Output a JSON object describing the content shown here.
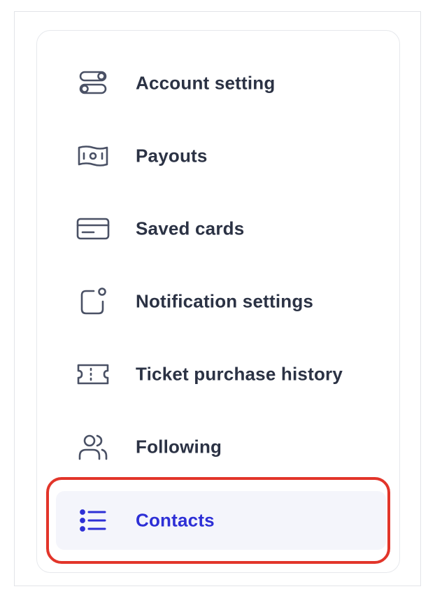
{
  "menu": {
    "items": [
      {
        "label": "Account setting",
        "icon": "toggle-settings-icon"
      },
      {
        "label": "Payouts",
        "icon": "banknote-icon"
      },
      {
        "label": "Saved cards",
        "icon": "credit-card-icon"
      },
      {
        "label": "Notification settings",
        "icon": "notification-icon"
      },
      {
        "label": "Ticket purchase history",
        "icon": "ticket-icon"
      },
      {
        "label": "Following",
        "icon": "users-icon"
      },
      {
        "label": "Contacts",
        "icon": "list-icon",
        "active": true
      }
    ]
  },
  "colors": {
    "text": "#2b3244",
    "icon": "#4a5165",
    "active_text": "#2d2fd6",
    "active_bg": "#f4f5fb",
    "highlight": "#e2352a"
  }
}
